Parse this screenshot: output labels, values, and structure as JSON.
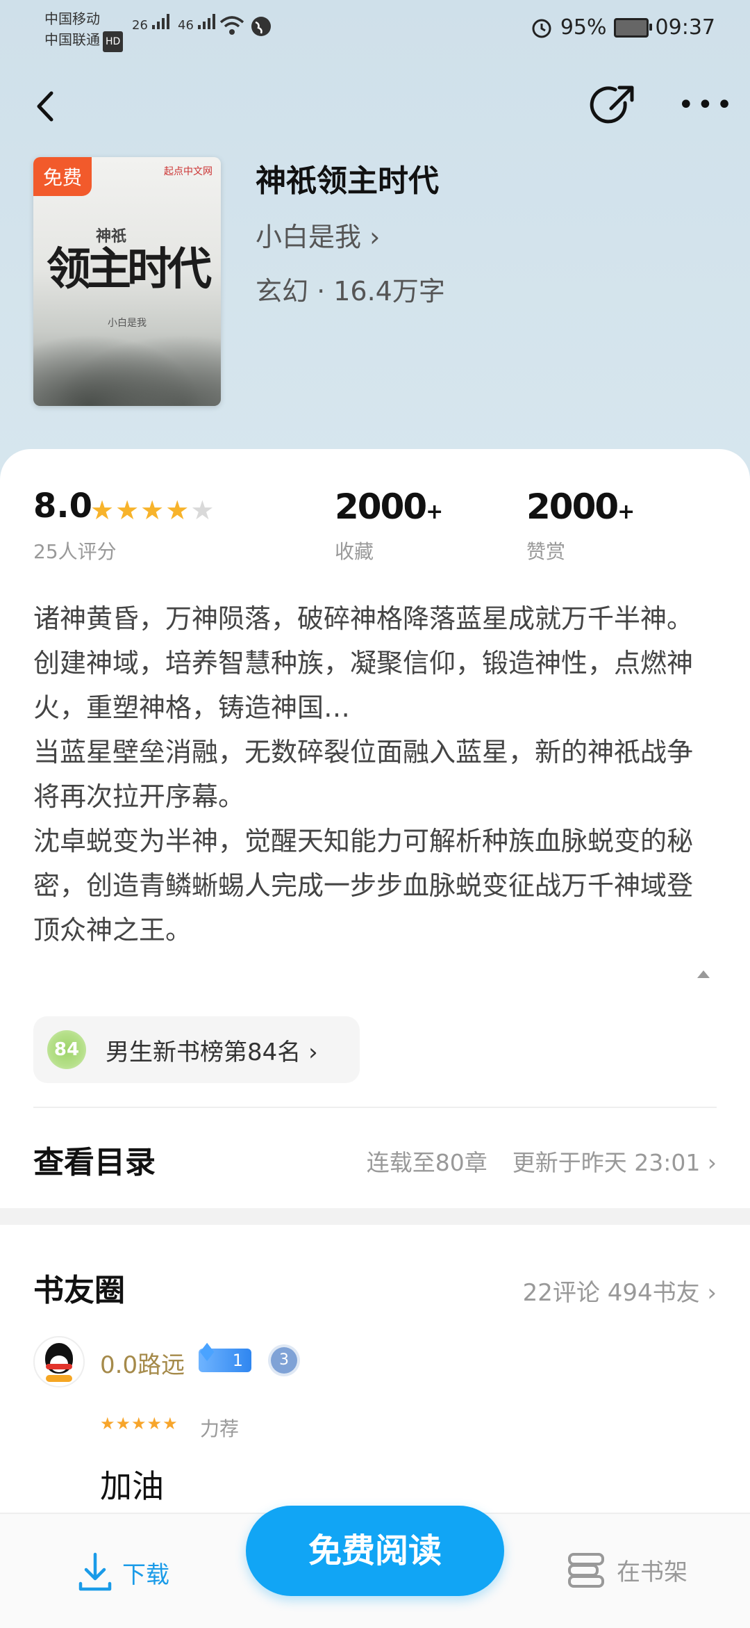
{
  "status_bar": {
    "carrier1": "中国移动",
    "carrier2": "中国联通",
    "hd": "HD",
    "sig1": "26",
    "sig2": "46",
    "battery": "95%",
    "time": "09:37"
  },
  "book": {
    "cover_tag": "免费",
    "cover_publisher": "起点中文网",
    "cover_title": "领主时代",
    "cover_subtitle": "神祇",
    "cover_author": "小白是我",
    "title": "神祇领主时代",
    "author": "小白是我 ›",
    "meta": "玄幻 · 16.4万字"
  },
  "stats": {
    "rating": "8.0",
    "rating_count": "25人评分",
    "stars_filled": 4,
    "stars_total": 5,
    "collect_num": "2000",
    "collect_plus": "+",
    "collect_label": "收藏",
    "reward_num": "2000",
    "reward_plus": "+",
    "reward_label": "赞赏"
  },
  "intro": {
    "p1": "诸神黄昏，万神陨落，破碎神格降落蓝星成就万千半神。",
    "p2": "创建神域，培养智慧种族，凝聚信仰，锻造神性，点燃神火，重塑神格，铸造神国…",
    "p3": "当蓝星壁垒消融，无数碎裂位面融入蓝星，新的神祇战争将再次拉开序幕。",
    "p4": "沈卓蜕变为半神，觉醒天知能力可解析种族血脉蜕变的秘密，创造青鳞蜥蜴人完成一步步血脉蜕变征战万千神域登顶众神之王。"
  },
  "rank": {
    "badge": "84",
    "text": "男生新书榜第84名  ›"
  },
  "toc": {
    "title": "查看目录",
    "serial": "连载至80章",
    "updated": "更新于昨天 23:01 ›"
  },
  "circle": {
    "title": "书友圈",
    "info": "22评论 494书友 ›",
    "comment": {
      "user": "0.0路远",
      "fan_level": "1",
      "user_level": "3",
      "stars": "★★★★★",
      "tag": "力荐",
      "text": "加油"
    }
  },
  "bottom": {
    "download": "下载",
    "read": "免费阅读",
    "shelf": "在书架"
  },
  "colors": {
    "accent": "#11a5f5",
    "star": "#f7b32b",
    "hero_bg": "#cfe0ea"
  }
}
